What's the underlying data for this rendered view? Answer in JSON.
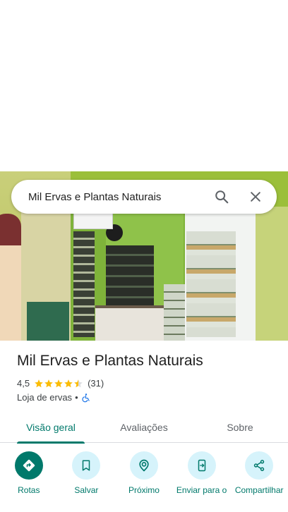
{
  "search": {
    "query": "Mil Ervas e Plantas Naturais"
  },
  "place": {
    "name": "Mil Ervas e Plantas Naturais",
    "rating": "4,5",
    "rating_value": 4.5,
    "reviews_count": "(31)",
    "category": "Loja de ervas",
    "separator": "•"
  },
  "tabs": [
    {
      "label": "Visão geral",
      "active": true
    },
    {
      "label": "Avaliações",
      "active": false
    },
    {
      "label": "Sobre",
      "active": false
    }
  ],
  "actions": [
    {
      "label": "Rotas",
      "icon": "directions-icon"
    },
    {
      "label": "Salvar",
      "icon": "bookmark-icon"
    },
    {
      "label": "Próximo",
      "icon": "nearby-icon"
    },
    {
      "label": "Enviar para o",
      "icon": "send-to-phone-icon"
    },
    {
      "label": "Compartilhar",
      "icon": "share-icon"
    }
  ],
  "colors": {
    "accent": "#00796b",
    "action_bg": "#d6f3fb",
    "star": "#fbbc04",
    "accessibility": "#1a73e8"
  }
}
